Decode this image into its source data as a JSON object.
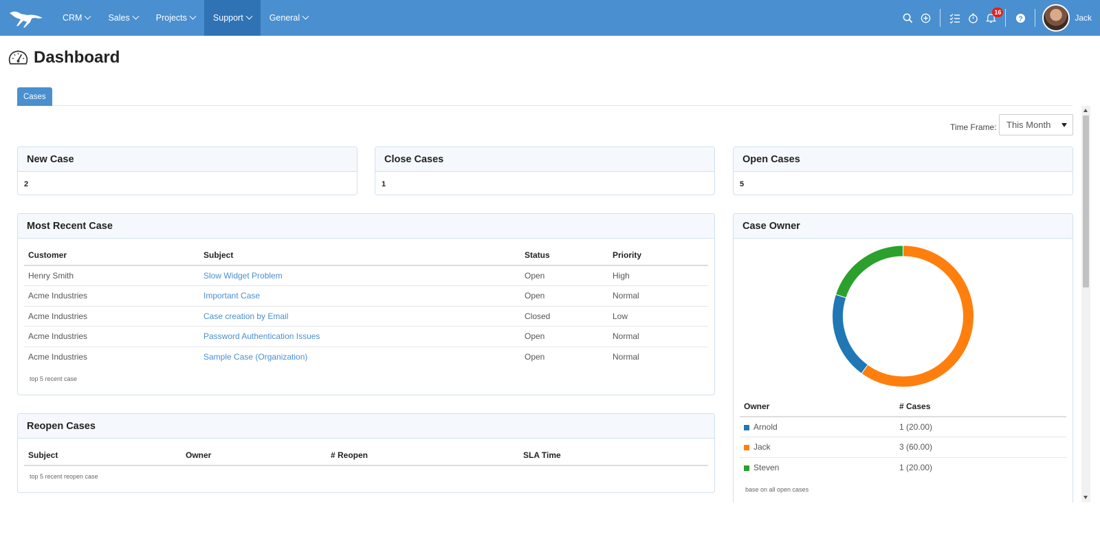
{
  "nav": {
    "items": [
      {
        "label": "CRM",
        "active": false
      },
      {
        "label": "Sales",
        "active": false
      },
      {
        "label": "Projects",
        "active": false
      },
      {
        "label": "Support",
        "active": true
      },
      {
        "label": "General",
        "active": false
      }
    ],
    "notifications": "16",
    "user_name": "Jack"
  },
  "page": {
    "title": "Dashboard"
  },
  "tabs": [
    {
      "label": "Cases"
    }
  ],
  "timeframe": {
    "label": "Time Frame:",
    "value": "This Month"
  },
  "stats": {
    "new_case": {
      "title": "New Case",
      "value": "2"
    },
    "close_cases": {
      "title": "Close Cases",
      "value": "1"
    },
    "open_cases": {
      "title": "Open Cases",
      "value": "5"
    }
  },
  "recent": {
    "title": "Most Recent Case",
    "columns": [
      "Customer",
      "Subject",
      "Status",
      "Priority"
    ],
    "rows": [
      [
        "Henry Smith",
        "Slow Widget Problem",
        "Open",
        "High"
      ],
      [
        "Acme Industries",
        "Important Case",
        "Open",
        "Normal"
      ],
      [
        "Acme Industries",
        "Case creation by Email",
        "Closed",
        "Low"
      ],
      [
        "Acme Industries",
        "Password Authentication Issues",
        "Open",
        "Normal"
      ],
      [
        "Acme Industries",
        "Sample Case (Organization)",
        "Open",
        "Normal"
      ]
    ],
    "footnote": "top 5 recent case"
  },
  "reopen": {
    "title": "Reopen Cases",
    "columns": [
      "Subject",
      "Owner",
      "# Reopen",
      "SLA Time"
    ],
    "footnote": "top 5 recent reopen case"
  },
  "owner": {
    "title": "Case Owner",
    "columns": [
      "Owner",
      "# Cases"
    ],
    "footnote": "base on all open cases"
  },
  "chart_data": {
    "type": "pie",
    "donut": true,
    "categories": [
      "Arnold",
      "Jack",
      "Steven"
    ],
    "values": [
      1,
      3,
      1
    ],
    "labels": [
      "1 (20.00)",
      "3 (60.00)",
      "1 (20.00)"
    ],
    "colors": [
      "#1f77b4",
      "#ff7f0e",
      "#2ca02c"
    ],
    "title": "",
    "legend": "table-below"
  }
}
